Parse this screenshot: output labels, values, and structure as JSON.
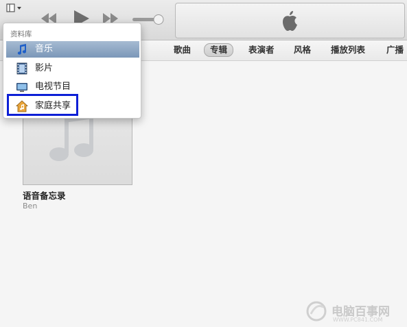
{
  "library_menu": {
    "header": "资料库",
    "items": [
      {
        "label": "音乐",
        "icon": "music-note-icon",
        "selected": true
      },
      {
        "label": "影片",
        "icon": "film-icon"
      },
      {
        "label": "电视节目",
        "icon": "tv-icon"
      },
      {
        "label": "家庭共享",
        "icon": "home-sharing-icon"
      }
    ]
  },
  "tabs": [
    {
      "label": "歌曲"
    },
    {
      "label": "专辑",
      "active": true
    },
    {
      "label": "表演者"
    },
    {
      "label": "风格"
    },
    {
      "label": "播放列表"
    },
    {
      "label": "广播"
    }
  ],
  "album": {
    "title": "语音备忘录",
    "artist": "Ben"
  },
  "watermark": {
    "name": "电脑百事网",
    "url": "WWW.PC841.COM"
  },
  "colors": {
    "highlight": "#0c1fd6",
    "selected_row": "#8aa3c1"
  }
}
